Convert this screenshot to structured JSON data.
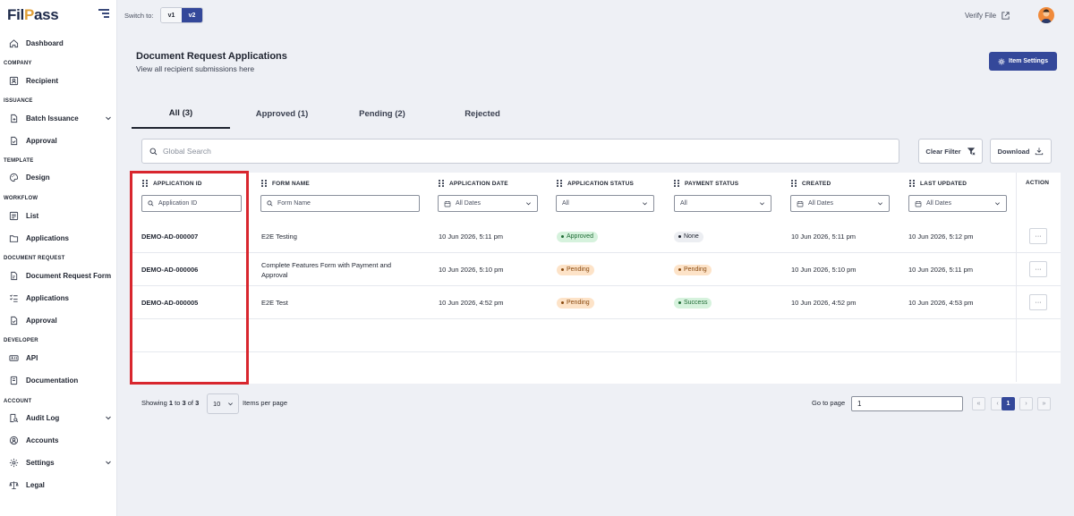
{
  "brand": {
    "logo_pre": "Fil",
    "logo_mark": "P",
    "logo_post": "ass"
  },
  "sidebar": {
    "top_item": "Dashboard",
    "sections": {
      "company": "COMPANY",
      "issuance": "ISSUANCE",
      "template": "TEMPLATE",
      "workflow": "WORKFLOW",
      "document_request": "DOCUMENT REQUEST",
      "developer": "DEVELOPER",
      "account": "ACCOUNT"
    },
    "items": {
      "recipient": "Recipient",
      "batch_issuance": "Batch Issuance",
      "approval_issuance": "Approval",
      "design": "Design",
      "list": "List",
      "applications_workflow": "Applications",
      "document_request_form": "Document Request Form",
      "applications_docreq": "Applications",
      "approval_docreq": "Approval",
      "api": "API",
      "documentation": "Documentation",
      "audit_log": "Audit Log",
      "accounts": "Accounts",
      "settings": "Settings",
      "legal": "Legal"
    }
  },
  "topbar": {
    "switch_label": "Switch to:",
    "v1": "v1",
    "v2": "v2",
    "verify_file": "Verify File"
  },
  "header": {
    "title": "Document Request Applications",
    "subtitle": "View all recipient submissions here",
    "item_settings": "Item Settings"
  },
  "tabs": [
    {
      "label": "All (3)"
    },
    {
      "label": "Approved (1)"
    },
    {
      "label": "Pending (2)"
    },
    {
      "label": "Rejected"
    }
  ],
  "filters": {
    "global_search_placeholder": "Global Search",
    "clear_filter": "Clear Filter",
    "download": "Download"
  },
  "table": {
    "columns": {
      "application_id": "APPLICATION ID",
      "form_name": "FORM NAME",
      "application_date": "APPLICATION DATE",
      "application_status": "APPLICATION STATUS",
      "payment_status": "PAYMENT STATUS",
      "created": "CREATED",
      "last_updated": "LAST UPDATED",
      "action": "ACTION"
    },
    "column_filters": {
      "application_id": "Application ID",
      "form_name": "Form Name",
      "application_date": "All Dates",
      "application_status": "All",
      "payment_status": "All",
      "created": "All Dates",
      "last_updated": "All Dates"
    },
    "rows": [
      {
        "id": "DEMO-AD-000007",
        "form": "E2E Testing",
        "app_date": "10 Jun 2026, 5:11 pm",
        "app_status": "Approved",
        "pay_status": "None",
        "created": "10 Jun 2026, 5:11 pm",
        "updated": "10 Jun 2026, 5:12 pm",
        "action": "···"
      },
      {
        "id": "DEMO-AD-000006",
        "form": "Complete Features Form with Payment and Approval",
        "app_date": "10 Jun 2026, 5:10 pm",
        "app_status": "Pending",
        "pay_status": "Pending",
        "created": "10 Jun 2026, 5:10 pm",
        "updated": "10 Jun 2026, 5:11 pm",
        "action": "···"
      },
      {
        "id": "DEMO-AD-000005",
        "form": "E2E Test",
        "app_date": "10 Jun 2026, 4:52 pm",
        "app_status": "Pending",
        "pay_status": "Success",
        "created": "10 Jun 2026, 4:52 pm",
        "updated": "10 Jun 2026, 4:53 pm",
        "action": "···"
      }
    ]
  },
  "pagination": {
    "showing_pre": "Showing",
    "from": "1",
    "to_word": "to",
    "to": "3",
    "of_word": "of",
    "total": "3",
    "per_page": "10",
    "items_per_page": "Items per page",
    "go_to_page": "Go to page",
    "page_value": "1",
    "first": "«",
    "prev": "‹",
    "current": "1",
    "next": "›",
    "last": "»"
  },
  "colors": {
    "primary": "#34489a",
    "highlight": "#d8262e",
    "approved": "#d6f2dd",
    "pending": "#fde3c8"
  }
}
